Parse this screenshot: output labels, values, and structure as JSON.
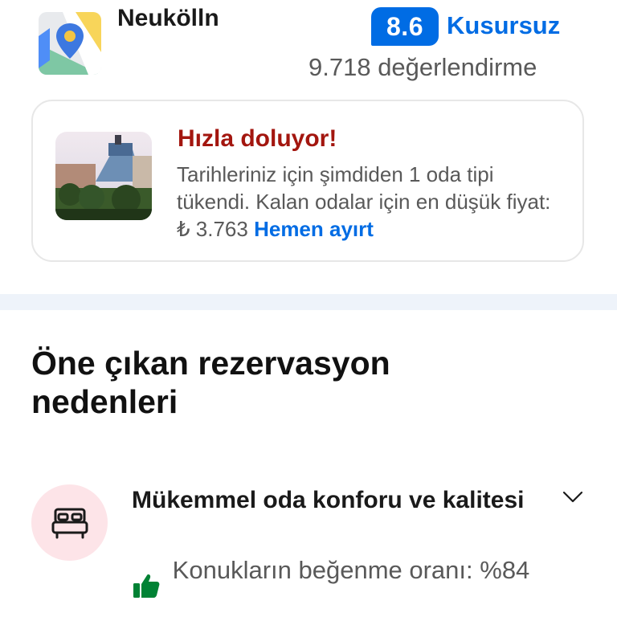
{
  "header": {
    "location": "Neukölln",
    "score": "8.6",
    "score_label": "Kusursuz",
    "review_count": "9.718 değerlendirme",
    "map_icon": "map-pin-icon"
  },
  "urgency_card": {
    "title": "Hızla doluyor!",
    "text": "Tarihleriniz için şimdiden 1 oda tipi tükendi. Kalan odalar için en düşük fiyat: ₺ 3.763",
    "link": "Hemen ayırt",
    "image": "hotel-photo"
  },
  "section": {
    "title": "Öne çıkan rezervasyon nedenleri"
  },
  "reason": {
    "icon": "bed-icon",
    "title": "Mükemmel oda konforu ve kalitesi",
    "approval": "Konukların beğenme oranı: %84",
    "expand_icon": "chevron-down-icon",
    "approval_icon": "thumbs-up-icon"
  },
  "colors": {
    "brand_blue": "#006ce4",
    "urgency_red": "#a3160f",
    "positive_green": "#008234",
    "bed_circle_bg": "#fde4e8",
    "divider": "#eef3fa"
  }
}
